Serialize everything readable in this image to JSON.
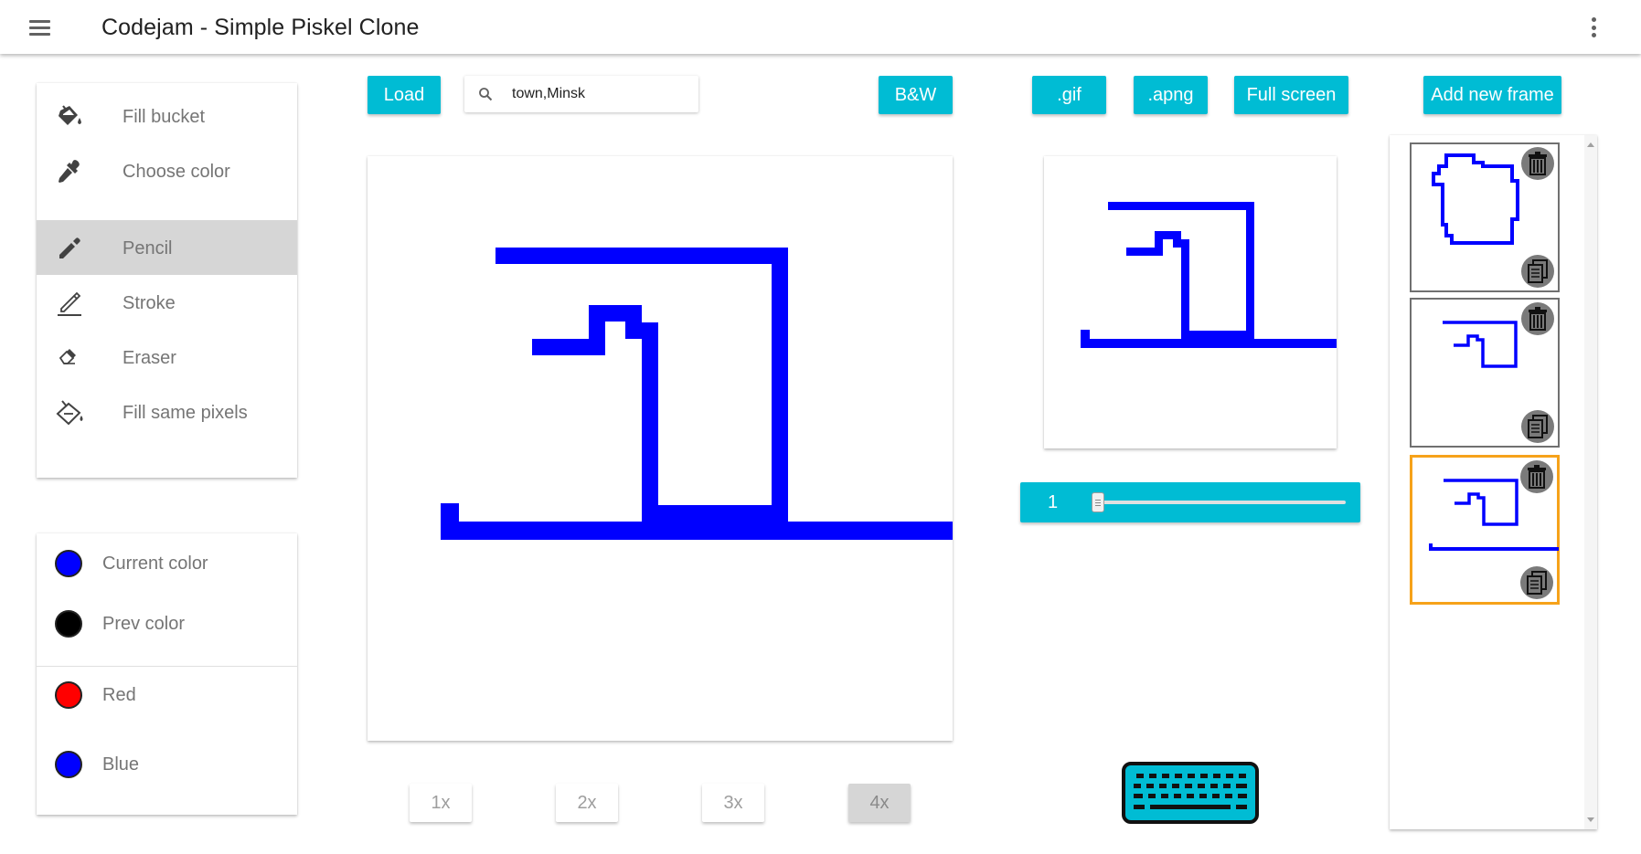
{
  "app": {
    "title": "Codejam - Simple Piskel Clone"
  },
  "tools": [
    {
      "label": "Fill bucket",
      "icon": "fill-bucket-icon",
      "active": false
    },
    {
      "label": "Choose color",
      "icon": "eyedropper-icon",
      "active": false
    },
    {
      "label": "Pencil",
      "icon": "pencil-icon",
      "active": true
    },
    {
      "label": "Stroke",
      "icon": "stroke-icon",
      "active": false
    },
    {
      "label": "Eraser",
      "icon": "eraser-icon",
      "active": false
    },
    {
      "label": "Fill same pixels",
      "icon": "fill-same-pixels-icon",
      "active": false
    }
  ],
  "colors": [
    {
      "label": "Current color",
      "color": "#0000ff"
    },
    {
      "label": "Prev color",
      "color": "#000000"
    },
    {
      "label": "Red",
      "color": "#ff0000"
    },
    {
      "label": "Blue",
      "color": "#0000ff"
    }
  ],
  "toolbar": {
    "load_label": "Load",
    "search_value": "town,Minsk",
    "bw_label": "B&W",
    "gif_label": ".gif",
    "apng_label": ".apng",
    "fullscreen_label": "Full screen",
    "add_frame_label": "Add new frame"
  },
  "zoom": {
    "options": [
      "1x",
      "2x",
      "3x",
      "4x"
    ],
    "selected": "4x"
  },
  "fps": {
    "value": "1"
  },
  "accent_color": "#00bcd4",
  "drawing_color": "#0000ff",
  "frames": {
    "count": 3,
    "selected_index": 2
  }
}
